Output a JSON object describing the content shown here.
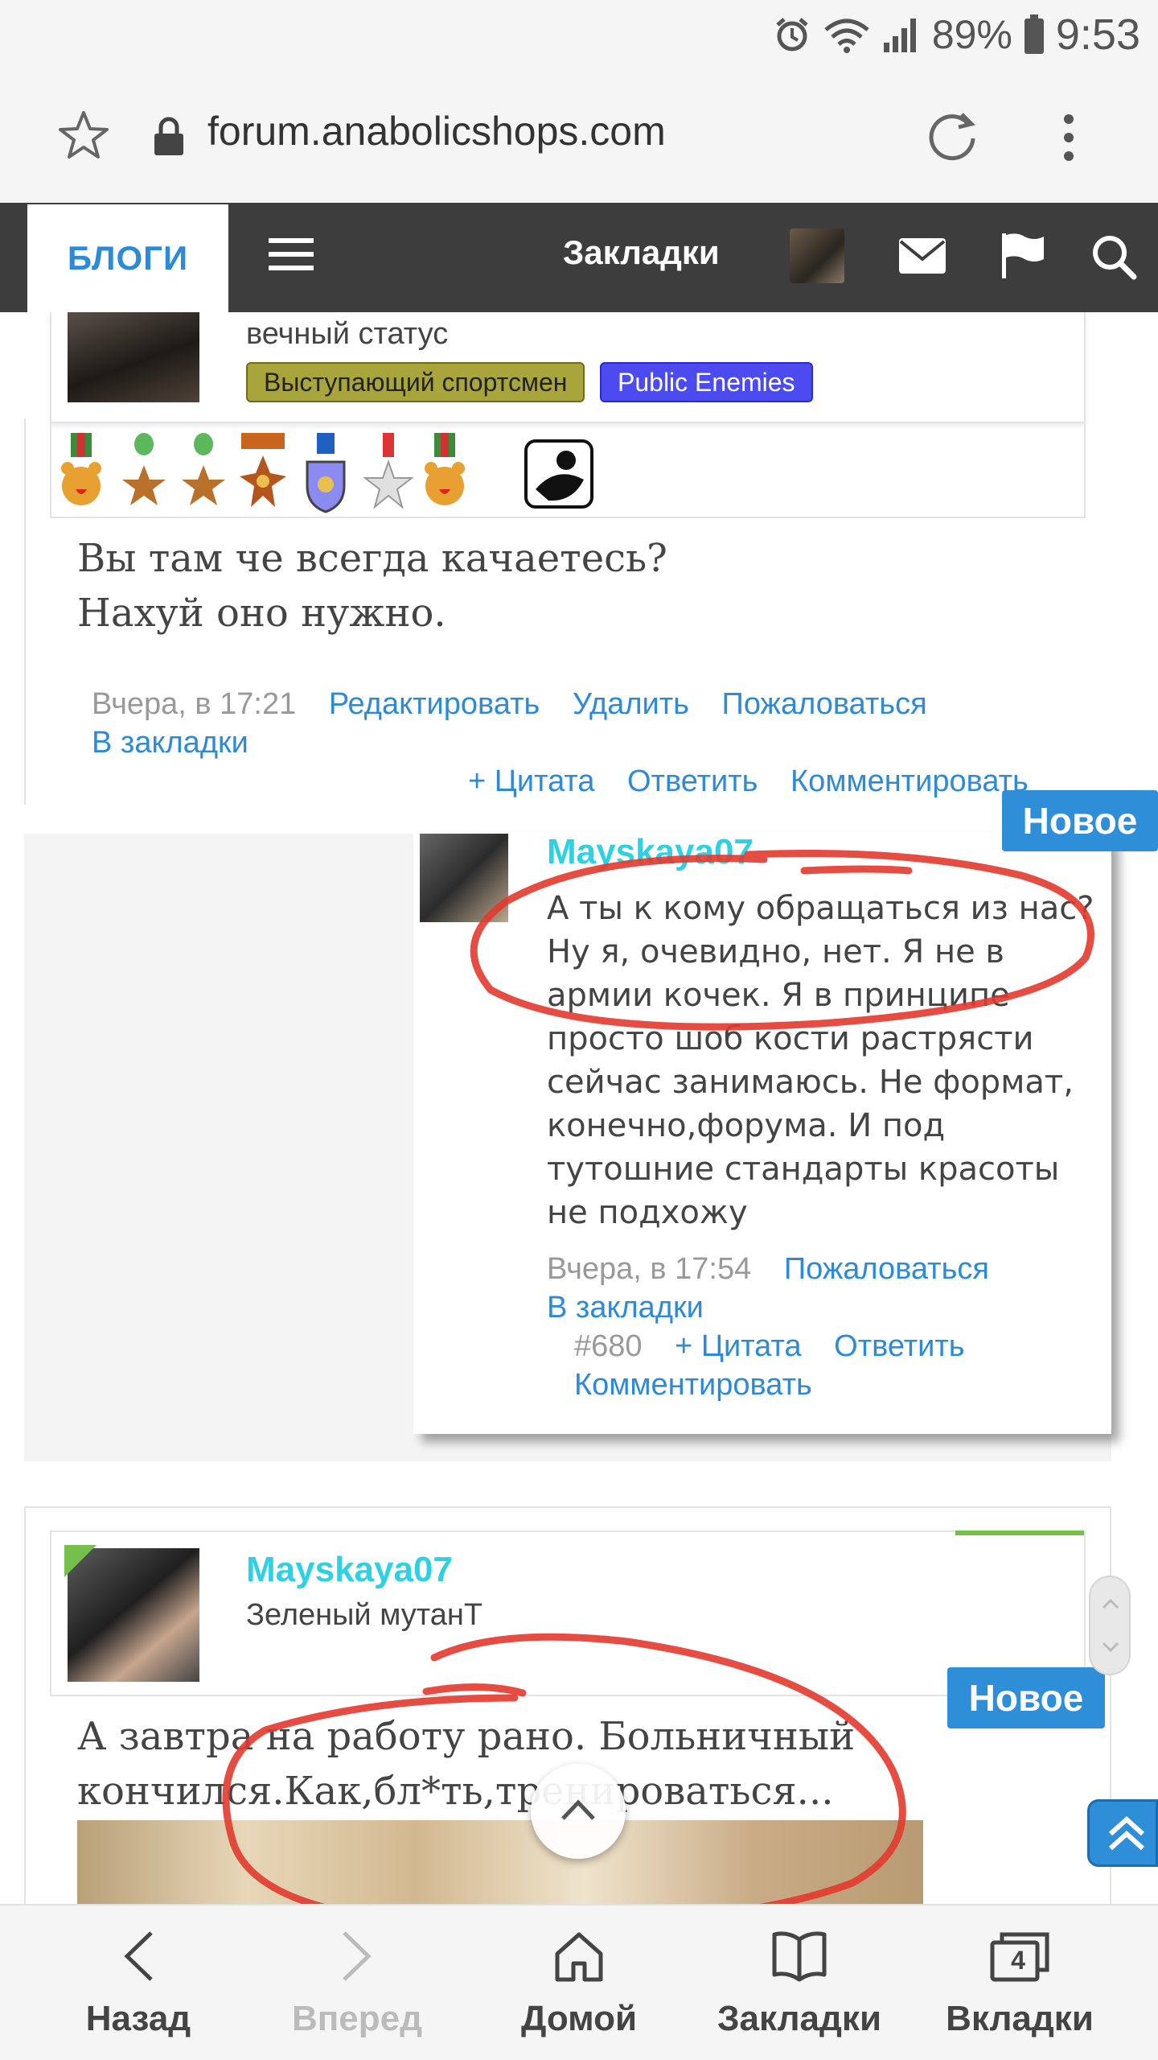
{
  "status_bar": {
    "battery_percent": "89%",
    "time": "9:53"
  },
  "address_bar": {
    "url": "forum.anabolicshops.com"
  },
  "forum_nav": {
    "active_tab": "БЛОГИ",
    "bookmarks_label": "Закладки"
  },
  "post1": {
    "user_status": "вечный статус",
    "badges": [
      "Выступающий спортсмен",
      "Public Enemies"
    ],
    "text_lines": [
      "Вы там че всегда качаетесь?",
      "Нахуй оно нужно."
    ],
    "timestamp": "Вчера, в 17:21",
    "actions": {
      "edit": "Редактировать",
      "delete": "Удалить",
      "report": "Пожаловаться",
      "bookmark": "В закладки"
    },
    "buttons": {
      "quote": "+ Цитата",
      "reply": "Ответить",
      "comment": "Комментировать"
    },
    "new_label": "Новое"
  },
  "reply": {
    "username": "Mayskaya07",
    "text": "А ты к кому обращаться из нас? Ну я, очевидно, нет. Я не в армии кочек. Я в принципе просто шоб кости растрясти сейчас занимаюсь. Не формат, конечно,форума. И под тутошние стандарты красоты не подхожу",
    "timestamp": "Вчера, в 17:54",
    "report": "Пожаловаться",
    "bookmark": "В закладки",
    "post_number": "#680",
    "quote": "+ Цитата",
    "answer": "Ответить",
    "comment": "Комментировать"
  },
  "post2": {
    "username": "Mayskaya07",
    "user_title": "Зеленый мутанТ",
    "new_label": "Новое",
    "text_lines": [
      "А завтра на работу рано. Больничный",
      "кончился.Как,бл*ть,тренироваться..."
    ]
  },
  "bottom_bar": {
    "back": "Назад",
    "forward": "Вперед",
    "home": "Домой",
    "bookmarks": "Закладки",
    "tabs": "Вкладки",
    "tab_count": "4"
  },
  "colors": {
    "link": "#2c8ad6",
    "username": "#2ed1e3",
    "nav_bg": "#3d3d3d",
    "annotation": "#e23a2e"
  }
}
